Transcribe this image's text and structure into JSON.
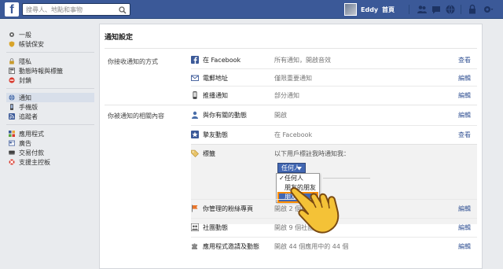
{
  "topbar": {
    "logo": "f",
    "search_placeholder": "搜尋人、地點和事物",
    "user_name": "Eddy",
    "home": "首頁"
  },
  "leftnav": {
    "groups": [
      [
        {
          "label": "一般",
          "icon": "gear-icon"
        },
        {
          "label": "帳號保安",
          "icon": "shield-icon"
        }
      ],
      [
        {
          "label": "隱私",
          "icon": "lock-icon"
        },
        {
          "label": "動態時報與標籤",
          "icon": "timeline-icon"
        },
        {
          "label": "封鎖",
          "icon": "block-icon"
        }
      ],
      [
        {
          "label": "通知",
          "icon": "globe-icon",
          "active": true
        },
        {
          "label": "手機版",
          "icon": "mobile-icon"
        },
        {
          "label": "追蹤者",
          "icon": "rss-icon"
        }
      ],
      [
        {
          "label": "應用程式",
          "icon": "apps-icon"
        },
        {
          "label": "廣告",
          "icon": "ads-icon"
        },
        {
          "label": "交易付款",
          "icon": "payments-icon"
        },
        {
          "label": "支援主控板",
          "icon": "lifebuoy-icon"
        }
      ]
    ]
  },
  "main": {
    "title": "通知設定",
    "section1_label": "你接收通知的方式",
    "section2_label": "你被通知的相關內容",
    "rows1": [
      {
        "name": "在 Facebook",
        "status": "所有通知，開啟音效",
        "action": "查看",
        "icon": "facebook-icon"
      },
      {
        "name": "電郵地址",
        "status": "僅限重要通知",
        "action": "編輯",
        "icon": "mail-icon"
      },
      {
        "name": "推播通知",
        "status": "部分通知",
        "action": "編輯",
        "icon": "phone-icon"
      }
    ],
    "rows2": [
      {
        "name": "與你有關的動態",
        "status": "開啟",
        "action": "編輯",
        "icon": "person-icon"
      },
      {
        "name": "摯友動態",
        "status": "在 Facebook",
        "action": "查看",
        "icon": "star-icon"
      }
    ],
    "tag_row": {
      "name": "標籤",
      "desc": "以下用戶標註我時通知我：",
      "dropdown_value": "任何人",
      "options": [
        "任何人",
        "朋友的朋友",
        "朋友"
      ],
      "selected_option": "任何人",
      "highlighted_option": "朋友"
    },
    "rows3": [
      {
        "name": "你管理的粉絲專頁",
        "status": "開啟 2 個粉絲專頁",
        "action": "編輯",
        "icon": "flag-icon"
      },
      {
        "name": "社團動態",
        "status": "開啟 9 個社團",
        "action": "編輯",
        "icon": "group-icon"
      },
      {
        "name": "應用程式邀請及動態",
        "status": "開啟 44 個應用中的 44 個",
        "action": "編輯",
        "icon": "puzzle-icon"
      }
    ]
  },
  "colors": {
    "topbar": "#3b5998",
    "link": "#3b5998",
    "highlight_outline": "#ff8c00",
    "dropdown": "#4267b2"
  }
}
